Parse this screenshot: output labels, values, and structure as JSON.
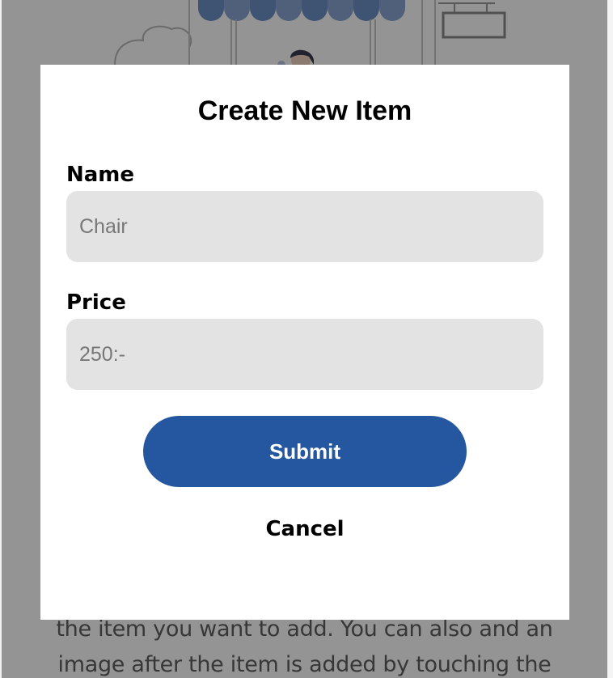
{
  "background": {
    "body_text_lines": [
      "the item you want to add. You can also and an",
      "image after the item is added by touching the"
    ]
  },
  "modal": {
    "title": "Create New Item",
    "name_field": {
      "label": "Name",
      "placeholder": "Chair",
      "value": ""
    },
    "price_field": {
      "label": "Price",
      "placeholder": "250:-",
      "value": ""
    },
    "submit_label": "Submit",
    "cancel_label": "Cancel"
  },
  "colors": {
    "primary_button": "#2557a0",
    "input_background": "#e3e3e3",
    "overlay": "rgba(0,0,0,0.42)"
  },
  "icons": {
    "header_illustration": "shop-stall-illustration"
  }
}
